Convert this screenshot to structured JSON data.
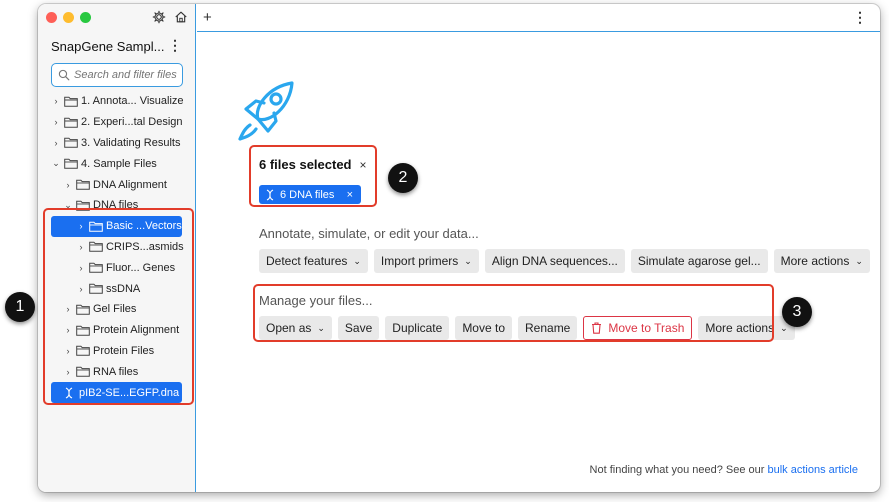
{
  "sidebar": {
    "project_title": "SnapGene Sampl...",
    "menu_glyph": "⋮",
    "search_placeholder": "Search and filter files",
    "items": [
      {
        "label": "1. Annota... Visualize",
        "chevron": "›",
        "level": 0,
        "selected": false
      },
      {
        "label": "2. Experi...tal Design",
        "chevron": "›",
        "level": 0,
        "selected": false
      },
      {
        "label": "3. Validating Results",
        "chevron": "›",
        "level": 0,
        "selected": false
      },
      {
        "label": "4. Sample Files",
        "chevron": "⌄",
        "level": 0,
        "selected": false
      },
      {
        "label": "DNA Alignment",
        "chevron": "›",
        "level": 1,
        "selected": false
      },
      {
        "label": "DNA files",
        "chevron": "⌄",
        "level": 1,
        "selected": false
      },
      {
        "label": "Basic ...Vectors",
        "chevron": "›",
        "level": 2,
        "selected": true
      },
      {
        "label": "CRIPS...asmids",
        "chevron": "›",
        "level": 2,
        "selected": false
      },
      {
        "label": "Fluor... Genes",
        "chevron": "›",
        "level": 2,
        "selected": false
      },
      {
        "label": "ssDNA",
        "chevron": "›",
        "level": 2,
        "selected": false
      },
      {
        "label": "Gel Files",
        "chevron": "›",
        "level": 1,
        "selected": false
      },
      {
        "label": "Protein Alignment",
        "chevron": "›",
        "level": 1,
        "selected": false
      },
      {
        "label": "Protein Files",
        "chevron": "›",
        "level": 1,
        "selected": false
      },
      {
        "label": "RNA files",
        "chevron": "›",
        "level": 1,
        "selected": false
      }
    ],
    "selected_file": "pIB2-SE...EGFP.dna"
  },
  "main": {
    "new_tab": "+",
    "menu_glyph": "⋮",
    "selection_title": "6 files selected",
    "selection_close": "×",
    "chip_label": "6 DNA files",
    "chip_close": "×",
    "annotate_label": "Annotate, simulate, or edit your data...",
    "annotate_buttons": [
      {
        "label": "Detect features",
        "caret": true
      },
      {
        "label": "Import primers",
        "caret": true
      },
      {
        "label": "Align DNA sequences...",
        "caret": false
      },
      {
        "label": "Simulate agarose gel...",
        "caret": false
      },
      {
        "label": "More actions",
        "caret": true
      }
    ],
    "manage_label": "Manage your files...",
    "manage_buttons": [
      {
        "label": "Open as",
        "caret": true
      },
      {
        "label": "Save",
        "caret": false
      },
      {
        "label": "Duplicate",
        "caret": false
      },
      {
        "label": "Move to",
        "caret": false
      },
      {
        "label": "Rename",
        "caret": false
      },
      {
        "label": "Move to Trash",
        "caret": false,
        "danger": true
      },
      {
        "label": "More actions",
        "caret": true
      }
    ],
    "footer_text": "Not finding what you need? See our ",
    "footer_link": "bulk actions article"
  },
  "callouts": [
    "1",
    "2",
    "3"
  ],
  "colors": {
    "accent": "#1a6ff0",
    "highlight": "#e23c2a",
    "divider": "#3a9be0"
  }
}
